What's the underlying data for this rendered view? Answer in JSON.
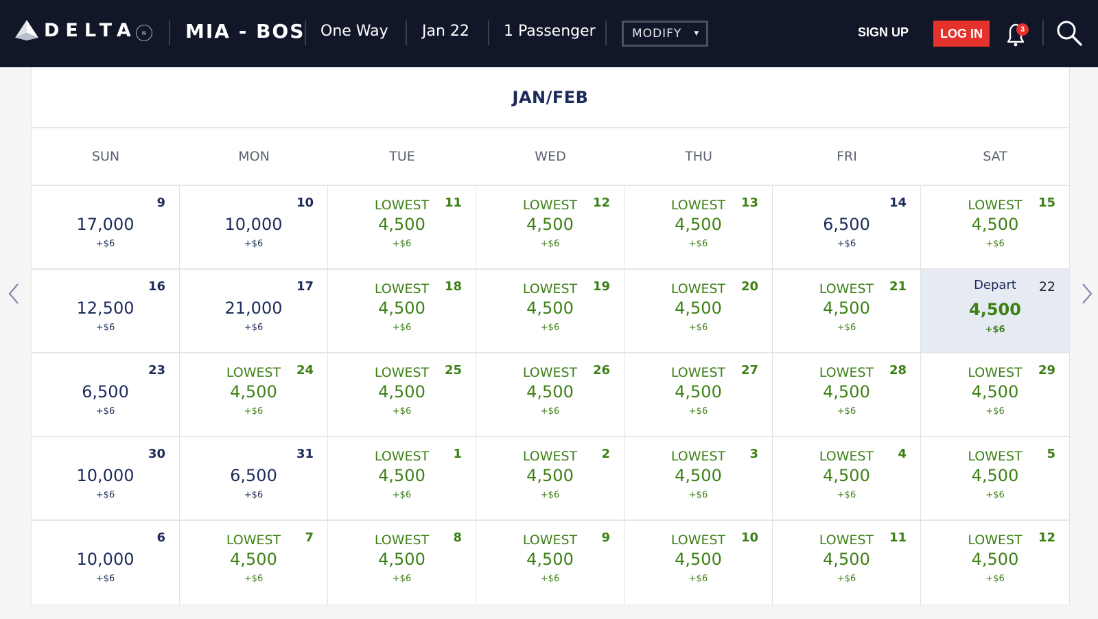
{
  "header": {
    "logo_text": "DELTA",
    "route": "MIA - BOS",
    "trip_type": "One Way",
    "date": "Jan 22",
    "passengers": "1 Passenger",
    "modify_label": "MODIFY",
    "signup_label": "SIGN UP",
    "login_label": "LOG IN",
    "notification_count": "3",
    "accent_color": "#e5322d",
    "bg_color": "#111729"
  },
  "calendar": {
    "title": "JAN/FEB",
    "days_of_week": [
      "SUN",
      "MON",
      "TUE",
      "WED",
      "THU",
      "FRI",
      "SAT"
    ],
    "lowest_label": "LOWEST",
    "colors": {
      "lowest": "#3d8016",
      "regular": "#1c2b5a",
      "selected_bg": "#e6ebf3"
    },
    "cells": [
      {
        "day": "9",
        "miles": "17,000",
        "fee": "+$6",
        "label": "",
        "lowest": false
      },
      {
        "day": "10",
        "miles": "10,000",
        "fee": "+$6",
        "label": "",
        "lowest": false
      },
      {
        "day": "11",
        "miles": "4,500",
        "fee": "+$6",
        "label": "LOWEST",
        "lowest": true
      },
      {
        "day": "12",
        "miles": "4,500",
        "fee": "+$6",
        "label": "LOWEST",
        "lowest": true
      },
      {
        "day": "13",
        "miles": "4,500",
        "fee": "+$6",
        "label": "LOWEST",
        "lowest": true
      },
      {
        "day": "14",
        "miles": "6,500",
        "fee": "+$6",
        "label": "",
        "lowest": false
      },
      {
        "day": "15",
        "miles": "4,500",
        "fee": "+$6",
        "label": "LOWEST",
        "lowest": true
      },
      {
        "day": "16",
        "miles": "12,500",
        "fee": "+$6",
        "label": "",
        "lowest": false
      },
      {
        "day": "17",
        "miles": "21,000",
        "fee": "+$6",
        "label": "",
        "lowest": false
      },
      {
        "day": "18",
        "miles": "4,500",
        "fee": "+$6",
        "label": "LOWEST",
        "lowest": true
      },
      {
        "day": "19",
        "miles": "4,500",
        "fee": "+$6",
        "label": "LOWEST",
        "lowest": true
      },
      {
        "day": "20",
        "miles": "4,500",
        "fee": "+$6",
        "label": "LOWEST",
        "lowest": true
      },
      {
        "day": "21",
        "miles": "4,500",
        "fee": "+$6",
        "label": "LOWEST",
        "lowest": true
      },
      {
        "day": "22",
        "miles": "4,500",
        "fee": "+$6",
        "label": "Depart",
        "lowest": true,
        "selected": true
      },
      {
        "day": "23",
        "miles": "6,500",
        "fee": "+$6",
        "label": "",
        "lowest": false
      },
      {
        "day": "24",
        "miles": "4,500",
        "fee": "+$6",
        "label": "LOWEST",
        "lowest": true
      },
      {
        "day": "25",
        "miles": "4,500",
        "fee": "+$6",
        "label": "LOWEST",
        "lowest": true
      },
      {
        "day": "26",
        "miles": "4,500",
        "fee": "+$6",
        "label": "LOWEST",
        "lowest": true
      },
      {
        "day": "27",
        "miles": "4,500",
        "fee": "+$6",
        "label": "LOWEST",
        "lowest": true
      },
      {
        "day": "28",
        "miles": "4,500",
        "fee": "+$6",
        "label": "LOWEST",
        "lowest": true
      },
      {
        "day": "29",
        "miles": "4,500",
        "fee": "+$6",
        "label": "LOWEST",
        "lowest": true
      },
      {
        "day": "30",
        "miles": "10,000",
        "fee": "+$6",
        "label": "",
        "lowest": false
      },
      {
        "day": "31",
        "miles": "6,500",
        "fee": "+$6",
        "label": "",
        "lowest": false
      },
      {
        "day": "1",
        "miles": "4,500",
        "fee": "+$6",
        "label": "LOWEST",
        "lowest": true
      },
      {
        "day": "2",
        "miles": "4,500",
        "fee": "+$6",
        "label": "LOWEST",
        "lowest": true
      },
      {
        "day": "3",
        "miles": "4,500",
        "fee": "+$6",
        "label": "LOWEST",
        "lowest": true
      },
      {
        "day": "4",
        "miles": "4,500",
        "fee": "+$6",
        "label": "LOWEST",
        "lowest": true
      },
      {
        "day": "5",
        "miles": "4,500",
        "fee": "+$6",
        "label": "LOWEST",
        "lowest": true
      },
      {
        "day": "6",
        "miles": "10,000",
        "fee": "+$6",
        "label": "",
        "lowest": false
      },
      {
        "day": "7",
        "miles": "4,500",
        "fee": "+$6",
        "label": "LOWEST",
        "lowest": true
      },
      {
        "day": "8",
        "miles": "4,500",
        "fee": "+$6",
        "label": "LOWEST",
        "lowest": true
      },
      {
        "day": "9",
        "miles": "4,500",
        "fee": "+$6",
        "label": "LOWEST",
        "lowest": true
      },
      {
        "day": "10",
        "miles": "4,500",
        "fee": "+$6",
        "label": "LOWEST",
        "lowest": true
      },
      {
        "day": "11",
        "miles": "4,500",
        "fee": "+$6",
        "label": "LOWEST",
        "lowest": true
      },
      {
        "day": "12",
        "miles": "4,500",
        "fee": "+$6",
        "label": "LOWEST",
        "lowest": true
      }
    ]
  },
  "icons": {
    "logo": "delta-widget-icon",
    "skyteam": "skyteam-badge-icon",
    "caret": "caret-down-icon",
    "bell": "bell-icon",
    "search": "search-icon",
    "prev": "chevron-left-icon",
    "next": "chevron-right-icon"
  }
}
